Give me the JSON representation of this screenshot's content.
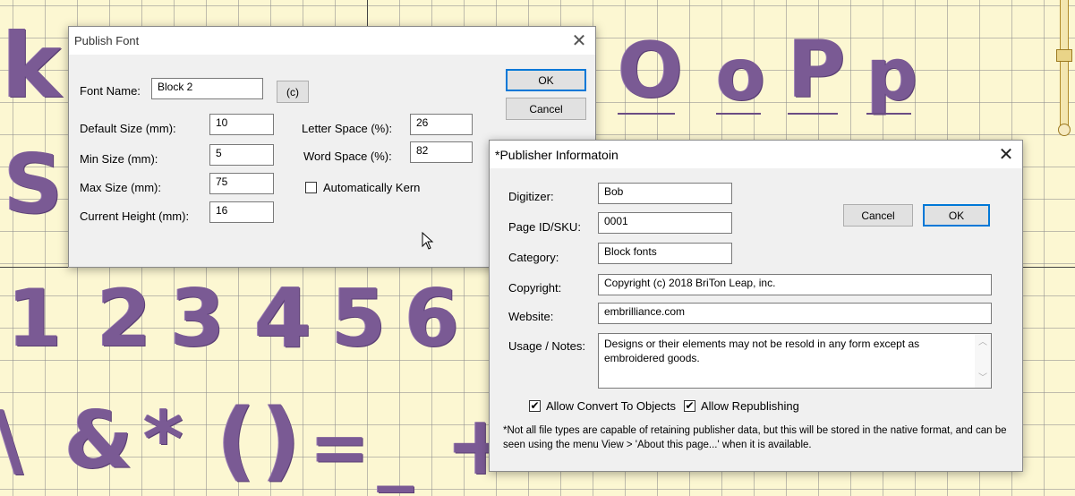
{
  "canvas": {
    "glyphs_top": [
      "k",
      "O",
      "o",
      "P",
      "p"
    ],
    "glyphs_s": "S",
    "glyphs_digits": [
      "1",
      "2",
      "3",
      "4",
      "5",
      "6"
    ],
    "glyphs_bottom": [
      "\\",
      "&",
      "*",
      "(",
      ")",
      "=",
      "_",
      "+"
    ],
    "thread_color": "#7a5a94",
    "background_color": "#fcf7d2"
  },
  "publish_font": {
    "title": "Publish Font",
    "font_name_label": "Font Name:",
    "font_name_value": "Block 2",
    "copyright_button": "(c)",
    "ok_label": "OK",
    "cancel_label": "Cancel",
    "default_size_label": "Default Size (mm):",
    "default_size_value": "10",
    "min_size_label": "Min Size (mm):",
    "min_size_value": "5",
    "max_size_label": "Max Size (mm):",
    "max_size_value": "75",
    "current_height_label": "Current Height (mm):",
    "current_height_value": "16",
    "letter_space_label": "Letter Space (%):",
    "letter_space_value": "26",
    "word_space_label": "Word Space (%):",
    "word_space_value": "82",
    "auto_kern_label": "Automatically Kern",
    "auto_kern_checked": false
  },
  "publisher_info": {
    "title": "*Publisher Informatoin",
    "digitizer_label": "Digitizer:",
    "digitizer_value": "Bob",
    "page_id_label": "Page ID/SKU:",
    "page_id_value": "0001",
    "category_label": "Category:",
    "category_value": "Block fonts",
    "copyright_label": "Copyright:",
    "copyright_value": "Copyright (c) 2018 BriTon Leap, inc.",
    "website_label": "Website:",
    "website_value": "embrilliance.com",
    "usage_label": "Usage / Notes:",
    "usage_value": "Designs or their elements may not be resold in any form except as embroidered goods.",
    "cancel_label": "Cancel",
    "ok_label": "OK",
    "allow_convert_label": "Allow Convert To Objects",
    "allow_convert_checked": true,
    "allow_republish_label": "Allow Republishing",
    "allow_republish_checked": true,
    "footnote": "*Not all file types are capable of retaining publisher data, but this will be stored in the native format, and can be seen using the menu View > 'About this page...' when it is available."
  },
  "check_glyph": "✔",
  "close_glyph": "✕"
}
